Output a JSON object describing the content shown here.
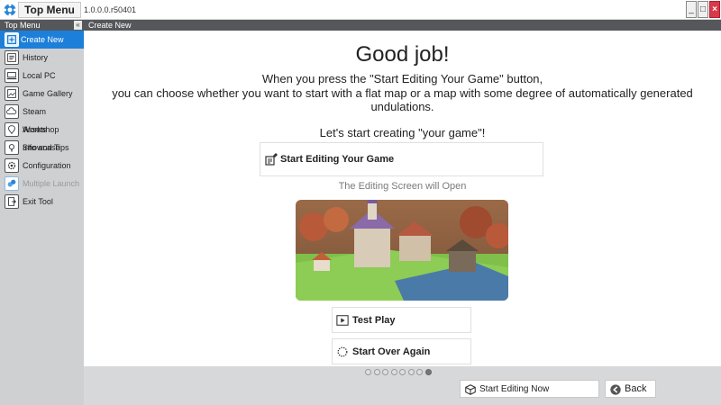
{
  "window": {
    "title": "Top Menu",
    "version": "1.0.0.0.r50401",
    "minimize": "_",
    "maximize": "□",
    "close": "×"
  },
  "sidebar": {
    "header": "Top Menu",
    "collapse": "«",
    "items": [
      {
        "label": "Create New",
        "icon": "create-new-icon"
      },
      {
        "label": "History",
        "icon": "history-icon"
      },
      {
        "label": "Local PC",
        "icon": "laptop-icon"
      },
      {
        "label": "Game Gallery",
        "icon": "gallery-icon"
      },
      {
        "label": "Steam Workshop",
        "icon": "cloud-icon"
      },
      {
        "label": "Assets Showcase",
        "icon": "showcase-icon"
      },
      {
        "label": "Info and Tips",
        "icon": "lightbulb-icon"
      },
      {
        "label": "Configuration",
        "icon": "gear-icon"
      },
      {
        "label": "Multiple Launch",
        "icon": "multi-launch-icon"
      },
      {
        "label": "Exit Tool",
        "icon": "exit-icon"
      }
    ]
  },
  "content": {
    "header": "Create New",
    "heading": "Good job!",
    "line1": "When you press the \"Start Editing Your Game\" button,",
    "line2": "you can choose whether you want to start with a flat map or a map with some degree of automatically generated",
    "line3": "undulations.",
    "line4": "Let's start creating \"your game\"!",
    "start_editing_label": "Start Editing Your Game",
    "editing_note": "The Editing Screen will Open",
    "test_play_label": "Test Play",
    "start_over_label": "Start Over Again"
  },
  "pager": {
    "total": 8,
    "active": 7
  },
  "footer": {
    "start_now_label": "Start Editing Now",
    "back_label": "Back"
  },
  "colors": {
    "accent": "#1c7fd9",
    "close": "#d93a4a",
    "header_bar": "#55575a",
    "sidebar_bg": "#cfd0d2"
  }
}
